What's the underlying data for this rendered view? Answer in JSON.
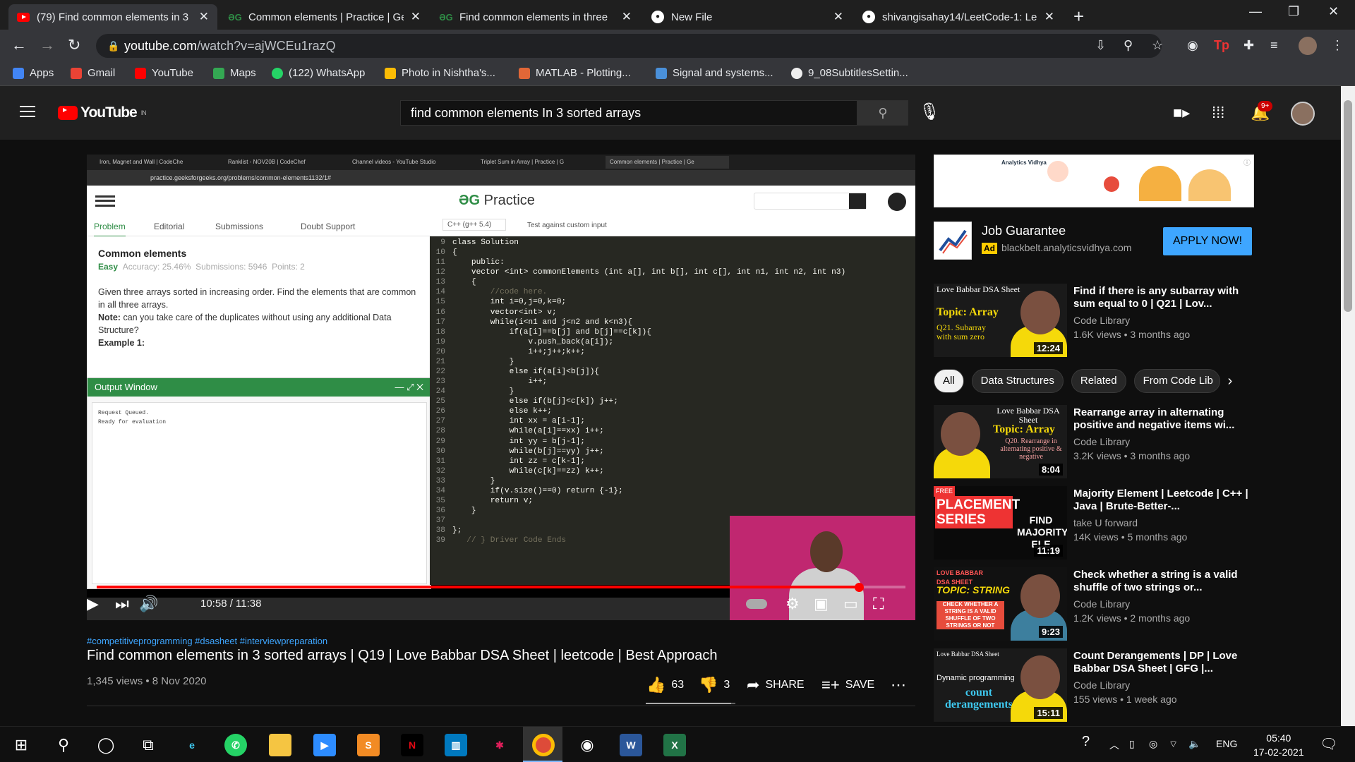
{
  "browser": {
    "tabs": [
      {
        "title": "(79) Find common elements in 3",
        "favicon": "youtube-icon",
        "active": true
      },
      {
        "title": "Common elements | Practice | Ge",
        "favicon": "gfg-icon",
        "active": false
      },
      {
        "title": "Find common elements in three",
        "favicon": "gfg-icon",
        "active": false
      },
      {
        "title": "New File",
        "favicon": "github-icon",
        "active": false
      },
      {
        "title": "shivangisahay14/LeetCode-1: Le",
        "favicon": "github-icon",
        "active": false
      }
    ],
    "url_host": "youtube.com",
    "url_path": "/watch?v=ajWCEu1razQ",
    "bookmarks": [
      {
        "label": "Apps",
        "color": "#4285f4"
      },
      {
        "label": "Gmail",
        "color": "#ea4335"
      },
      {
        "label": "YouTube",
        "color": "#ff0000"
      },
      {
        "label": "Maps",
        "color": "#34a853"
      },
      {
        "label": "(122) WhatsApp",
        "color": "#25d366"
      },
      {
        "label": "Photo in Nishtha's...",
        "color": "#fbbc05"
      },
      {
        "label": "MATLAB - Plotting...",
        "color": "#e16737"
      },
      {
        "label": "Signal and systems...",
        "color": "#4a90d9"
      },
      {
        "label": "9_08SubtitlesSettin...",
        "color": "#eeeeee"
      }
    ]
  },
  "youtube": {
    "logo_text": "YouTube",
    "logo_region": "IN",
    "search_query": "find common elements In 3 sorted arrays",
    "notification_count": "9+"
  },
  "video_frame": {
    "tabs": [
      "Iron, Magnet and Wall | CodeChe",
      "Ranklist - NOV20B | CodeChef",
      "Channel videos - YouTube Studio",
      "Triplet Sum in Array | Practice | G",
      "Common elements | Practice | Ge"
    ],
    "url": "practice.geeksforgeeks.org/problems/common-elements1132/1#",
    "brand": "Practice",
    "nav_tabs": [
      "Problem",
      "Editorial",
      "Submissions",
      "Doubt Support"
    ],
    "language": "C++ (g++ 5.4)",
    "custom_input": "Test against custom input",
    "problem_title": "Common elements",
    "difficulty": "Easy",
    "accuracy": "Accuracy: 25.46%",
    "submissions": "Submissions: 5946",
    "points": "Points: 2",
    "description": "Given three arrays sorted in increasing order. Find the elements that are common in all three arrays.",
    "note_label": "Note:",
    "note": "can you take care of the duplicates without using any additional Data Structure?",
    "example": "Example 1:",
    "output_title": "Output Window",
    "output_line1": "Request Queued.",
    "output_line2": "Ready for evaluation",
    "code_lines": [
      {
        "n": "9",
        "t": "class Solution"
      },
      {
        "n": "10",
        "t": "{"
      },
      {
        "n": "11",
        "t": "    public:"
      },
      {
        "n": "12",
        "t": "    vector <int> commonElements (int a[], int b[], int c[], int n1, int n2, int n3)"
      },
      {
        "n": "13",
        "t": "    {"
      },
      {
        "n": "14",
        "t": "        //code here."
      },
      {
        "n": "15",
        "t": "        int i=0,j=0,k=0;"
      },
      {
        "n": "16",
        "t": "        vector<int> v;"
      },
      {
        "n": "17",
        "t": "        while(i<n1 and j<n2 and k<n3){"
      },
      {
        "n": "18",
        "t": "            if(a[i]==b[j] and b[j]==c[k]){"
      },
      {
        "n": "19",
        "t": "                v.push_back(a[i]);"
      },
      {
        "n": "20",
        "t": "                i++;j++;k++;"
      },
      {
        "n": "21",
        "t": "            }"
      },
      {
        "n": "22",
        "t": "            else if(a[i]<b[j]){"
      },
      {
        "n": "23",
        "t": "                i++;"
      },
      {
        "n": "24",
        "t": "            }"
      },
      {
        "n": "25",
        "t": "            else if(b[j]<c[k]) j++;"
      },
      {
        "n": "26",
        "t": "            else k++;"
      },
      {
        "n": "27",
        "t": "            int xx = a[i-1];"
      },
      {
        "n": "28",
        "t": "            while(a[i]==xx) i++;"
      },
      {
        "n": "29",
        "t": "            int yy = b[j-1];"
      },
      {
        "n": "30",
        "t": "            while(b[j]==yy) j++;"
      },
      {
        "n": "31",
        "t": "            int zz = c[k-1];"
      },
      {
        "n": "32",
        "t": "            while(c[k]==zz) k++;"
      },
      {
        "n": "33",
        "t": "        }"
      },
      {
        "n": "34",
        "t": "        if(v.size()==0) return {-1};"
      },
      {
        "n": "35",
        "t": "        return v;"
      },
      {
        "n": "36",
        "t": "    }"
      },
      {
        "n": "37",
        "t": ""
      },
      {
        "n": "38",
        "t": "};"
      },
      {
        "n": "39",
        "t": "   // } Driver Code Ends"
      }
    ]
  },
  "player": {
    "time": "10:58 / 11:38",
    "progress": 0.942
  },
  "video": {
    "hashtags": "#competitiveprogramming #dsasheet #interviewpreparation",
    "title": "Find common elements in 3 sorted arrays | Q19 | Love Babbar DSA Sheet | leetcode | Best Approach",
    "views": "1,345 views • 8 Nov 2020",
    "likes": "63",
    "dislikes": "3",
    "share": "SHARE",
    "save": "SAVE"
  },
  "ad": {
    "title": "Job Guarantee",
    "badge": "Ad",
    "url": "blackbelt.analyticsvidhya.com",
    "cta": "APPLY NOW!",
    "banner_brand": "Analytics Vidhya"
  },
  "chips": [
    "All",
    "Data Structures",
    "Related",
    "From Code Lib"
  ],
  "recommendations": [
    {
      "title": "Find if there is any subarray with sum equal to 0 | Q21 | Lov...",
      "channel": "Code Library",
      "meta": "1.6K views • 3 months ago",
      "duration": "12:24",
      "thumb_top": "Love Babbar DSA Sheet",
      "thumb_topic": "Topic: Array",
      "thumb_sub": "Q21. Subarray with sum zero"
    },
    {
      "title": "Rearrange array in alternating positive and negative items wi...",
      "channel": "Code Library",
      "meta": "3.2K views • 3 months ago",
      "duration": "8:04",
      "thumb_top": "Love Babbar DSA Sheet",
      "thumb_topic": "Topic: Array",
      "thumb_sub": "Q20. Rearrange in alternating positive & negative"
    },
    {
      "title": "Majority Element | Leetcode | C++ | Java | Brute-Better-...",
      "channel": "take U forward",
      "meta": "14K views • 5 months ago",
      "duration": "11:19",
      "thumb_top": "PLACEMENT SERIES",
      "thumb_topic": "FIND MAJORITY ELE",
      "thumb_sub": "FREE"
    },
    {
      "title": "Check whether a string is a valid shuffle of two strings or...",
      "channel": "Code Library",
      "meta": "1.2K views • 2 months ago",
      "duration": "9:23",
      "thumb_top": "LOVE BABBAR DSA SHEET",
      "thumb_topic": "TOPIC: STRING",
      "thumb_sub": "CHECK WHETHER A STRING IS A VALID SHUFFLE OF TWO STRINGS OR NOT"
    },
    {
      "title": "Count Derangements | DP | Love Babbar DSA Sheet | GFG |...",
      "channel": "Code Library",
      "meta": "155 views • 1 week ago",
      "duration": "15:11",
      "thumb_top": "Love Babbar DSA Sheet",
      "thumb_topic": "count derangements",
      "thumb_sub": "Dynamic programming"
    }
  ],
  "taskbar": {
    "language": "ENG",
    "time": "05:40",
    "date": "17-02-2021"
  }
}
